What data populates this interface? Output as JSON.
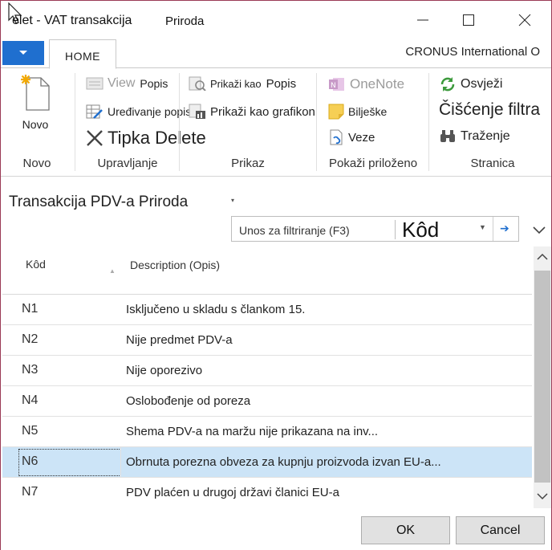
{
  "window": {
    "title": "elet - VAT transakcija",
    "subtitle": "Priroda"
  },
  "ribbon_tabs": {
    "home": "HOME",
    "company": "CRONUS International O"
  },
  "ribbon": {
    "groups": {
      "novo": "Novo",
      "upravljanje": "Upravljanje",
      "prikaz": "Prikaz",
      "prilozeno": "Pokaži priloženo",
      "stranica": "Stranica"
    },
    "items": {
      "novo": "Novo",
      "view": "View",
      "popis": "Popis",
      "uredjivanje": "Uređivanje popisa",
      "tipka_delete": "Tipka Delete",
      "prikazi_kao": "Prikaži kao",
      "prikazi_popis": "Popis",
      "prikazi_grafikon": "Prikaži kao grafikon",
      "onenote": "OneNote",
      "biljeske": "Bilješke",
      "veze": "Veze",
      "osvjezi": "Osvježi",
      "ciscenje": "Čišćenje filtra",
      "trazenje": "Traženje"
    }
  },
  "page": {
    "title": "Transakcija PDV-a  Priroda",
    "filter_placeholder": "Unos za filtriranje (F3)",
    "filter_field": "Kôd"
  },
  "grid": {
    "headers": {
      "code": "Kôd",
      "description": "Description (Opis)"
    },
    "rows": [
      {
        "code": "N1",
        "description": "Isključeno u skladu s člankom 15."
      },
      {
        "code": "N2",
        "description": "Nije predmet PDV-a"
      },
      {
        "code": "N3",
        "description": "Nije oporezivo"
      },
      {
        "code": "N4",
        "description": "Oslobođenje od poreza"
      },
      {
        "code": "N5",
        "description": "Shema PDV-a na maržu nije prikazana na inv..."
      },
      {
        "code": "N6",
        "description": "Obrnuta porezna obveza za kupnju proizvoda izvan EU-a..."
      },
      {
        "code": "N7",
        "description": "PDV plaćen u drugoj državi članici EU-a"
      }
    ],
    "selected_index": 5
  },
  "footer": {
    "ok": "OK",
    "cancel": "Cancel"
  },
  "colors": {
    "accent": "#1f6fcf",
    "selection": "#cce4f7",
    "border": "#9a3b56"
  }
}
